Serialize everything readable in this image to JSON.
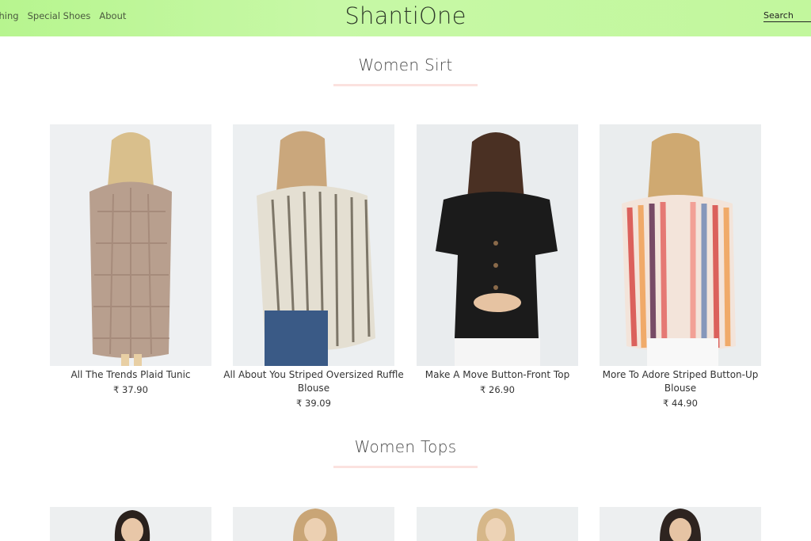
{
  "header": {
    "nav": [
      "thing",
      "Special Shoes",
      "About"
    ],
    "brand": "ShantiOne",
    "search_label": "Search"
  },
  "sections": [
    {
      "title": "Women Sirt",
      "products": [
        {
          "name": "All The Trends Plaid Tunic",
          "price": "₹ 37.90",
          "color": "#b89f8e"
        },
        {
          "name": "All About You Striped Oversized Ruffle Blouse",
          "price": "₹ 39.09",
          "color": "#d9d3c4"
        },
        {
          "name": "Make A Move Button-Front Top",
          "price": "₹ 26.90",
          "color": "#1b1b1b"
        },
        {
          "name": "More To Adore Striped Button-Up Blouse",
          "price": "₹ 44.90",
          "color": "#e0706a"
        }
      ]
    },
    {
      "title": "Women Tops"
    }
  ],
  "colors": {
    "header_bg": "#c5f7a0",
    "underline": "#fbe2df"
  }
}
